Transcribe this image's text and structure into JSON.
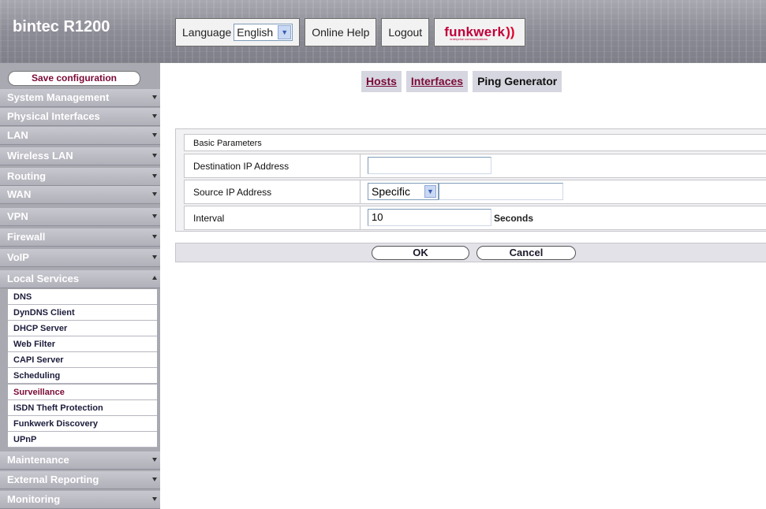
{
  "header": {
    "brand": "bintec R1200",
    "language_label": "Language",
    "language_value": "English",
    "online_help": "Online Help",
    "logout": "Logout",
    "logo_text": "funkwerk",
    "logo_subtext": "enterprise communications"
  },
  "sidebar": {
    "save_label": "Save configuration",
    "menu": [
      {
        "label": "System Management"
      },
      {
        "label": "Physical Interfaces"
      },
      {
        "label": "LAN"
      },
      {
        "label": "Wireless LAN"
      },
      {
        "label": "Routing"
      },
      {
        "label": "WAN"
      },
      {
        "label": "VPN"
      },
      {
        "label": "Firewall"
      },
      {
        "label": "VoIP"
      },
      {
        "label": "Local Services"
      }
    ],
    "submenu": [
      {
        "label": "DNS"
      },
      {
        "label": "DynDNS Client"
      },
      {
        "label": "DHCP Server"
      },
      {
        "label": "Web Filter"
      },
      {
        "label": "CAPI Server"
      },
      {
        "label": "Scheduling"
      },
      {
        "label": "Surveillance"
      },
      {
        "label": "ISDN Theft Protection"
      },
      {
        "label": "Funkwerk Discovery"
      },
      {
        "label": "UPnP"
      }
    ],
    "menu_after": [
      {
        "label": "Maintenance"
      },
      {
        "label": "External Reporting"
      },
      {
        "label": "Monitoring"
      }
    ]
  },
  "tabs": [
    {
      "label": "Hosts"
    },
    {
      "label": "Interfaces"
    },
    {
      "label": "Ping Generator"
    }
  ],
  "form": {
    "section_title": "Basic Parameters",
    "destination_label": "Destination IP Address",
    "destination_value": "",
    "source_label": "Source IP Address",
    "source_mode": "Specific",
    "source_value": "",
    "interval_label": "Interval",
    "interval_value": "10",
    "interval_unit": "Seconds"
  },
  "actions": {
    "ok": "OK",
    "cancel": "Cancel"
  },
  "colors": {
    "accent": "#7a0a36",
    "sidebar_bg": "#a9a9b2",
    "header_bg": "#8c8c96"
  }
}
